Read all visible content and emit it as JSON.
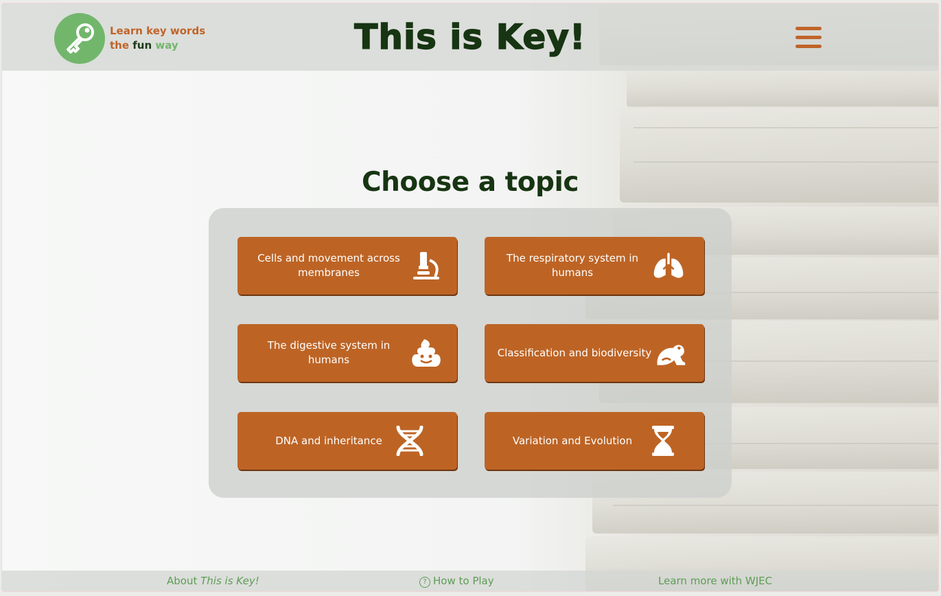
{
  "header": {
    "tagline_line1": "Learn key words",
    "tagline_the": "the",
    "tagline_fun": "fun",
    "tagline_way": "way",
    "title": "This is Key!",
    "logo_icon": "key-icon",
    "menu_icon": "hamburger-icon"
  },
  "main": {
    "heading": "Choose a topic",
    "topics": [
      {
        "label": "Cells and movement across membranes",
        "icon": "microscope-icon"
      },
      {
        "label": "The respiratory system in humans",
        "icon": "lungs-icon"
      },
      {
        "label": "The digestive system in humans",
        "icon": "poop-icon"
      },
      {
        "label": "Classification and biodiversity",
        "icon": "frog-icon"
      },
      {
        "label": "DNA and inheritance",
        "icon": "dna-icon"
      },
      {
        "label": "Variation and Evolution",
        "icon": "hourglass-icon"
      }
    ]
  },
  "footer": {
    "about_prefix": "About",
    "about_name": "This is Key!",
    "how_to_play": "How to Play",
    "learn_more": "Learn more with WJEC"
  },
  "colors": {
    "accent_orange": "#bd6425",
    "brand_green": "#72b66c",
    "title_dark_green": "#173512",
    "footer_link_green": "#5e9c56"
  }
}
